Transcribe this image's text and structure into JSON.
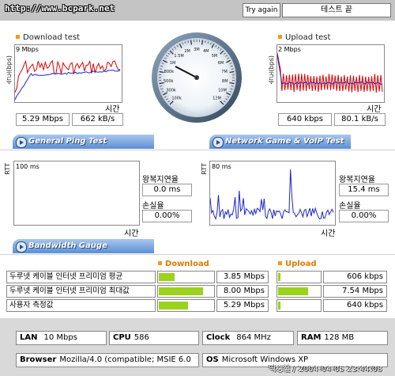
{
  "header": {
    "url": "http://www.bcpark.net",
    "try_again": "Try again",
    "end_test": "테스트 끝"
  },
  "download": {
    "title": "Download test",
    "ylabel": "속도(bps)",
    "max_label": "9 Mbps",
    "xlabel": "시간",
    "speed_mbps": "5.29 Mbps",
    "speed_kbs": "662 kB/s"
  },
  "upload": {
    "title": "Upload test",
    "ylabel": "속도(bps)",
    "max_label": "2 Mbps",
    "xlabel": "시간",
    "speed_kbps": "640 kbps",
    "speed_kbs": "80.1 kB/s"
  },
  "gauge": {
    "ticks": [
      "100k",
      "300k",
      "500k",
      "800k",
      "1M",
      "1.5M",
      "2M",
      "3M",
      "4M",
      "5M",
      "6M",
      "7M",
      "8M",
      "10M",
      "12M"
    ]
  },
  "tabs": {
    "ping": "General Ping Test",
    "game": "Network Game & VoIP Test",
    "bandwidth": "Bandwidth Gauge"
  },
  "ping": {
    "ylabel": "RTT",
    "max_label": "100 ms",
    "xlabel": "시간",
    "rtt_label": "왕복지연율",
    "rtt_value": "0.0 ms",
    "loss_label": "손실율",
    "loss_value": "0.00%"
  },
  "game": {
    "ylabel": "RTT",
    "max_label": "80 ms",
    "xlabel": "시간",
    "rtt_label": "왕복지연율",
    "rtt_value": "15.4 ms",
    "loss_label": "손실율",
    "loss_value": "0.00%"
  },
  "bandwidth": {
    "download_label": "Download",
    "upload_label": "Upload",
    "rows": [
      {
        "label": "두루넷 케이블 인터넷 프리미엄 평균",
        "down": "3.85 Mbps",
        "down_frac": 0.3,
        "up": "606 kbps",
        "up_frac": 0.06
      },
      {
        "label": "두루넷 케이블 인터넷 프리미엄 최대값",
        "down": "8.00 Mbps",
        "down_frac": 0.83,
        "up": "7.54 Mbps",
        "up_frac": 0.74
      },
      {
        "label": "사용자 측정값",
        "down": "5.29 Mbps",
        "down_frac": 0.55,
        "up": "640 kbps",
        "up_frac": 0.06
      }
    ]
  },
  "system": {
    "lan_label": "LAN",
    "lan": "10 Mbps",
    "cpu_label": "CPU",
    "cpu": "586",
    "clock_label": "Clock",
    "clock": "864 MHz",
    "ram_label": "RAM",
    "ram": "128 MB",
    "browser_label": "Browser",
    "browser": "Mozilla/4.0 (compatible; MSIE 6.0",
    "os_label": "OS",
    "os": "Microsoft Windows XP",
    "footer": "딱중철 / 2004-04-05 23:44:08"
  },
  "colors": {
    "accent": "#f39a1b",
    "tab_blue": "#5c8fd4",
    "bar_green": "#9bd21c",
    "series_red": "#e00000",
    "series_blue": "#1c24c8"
  }
}
